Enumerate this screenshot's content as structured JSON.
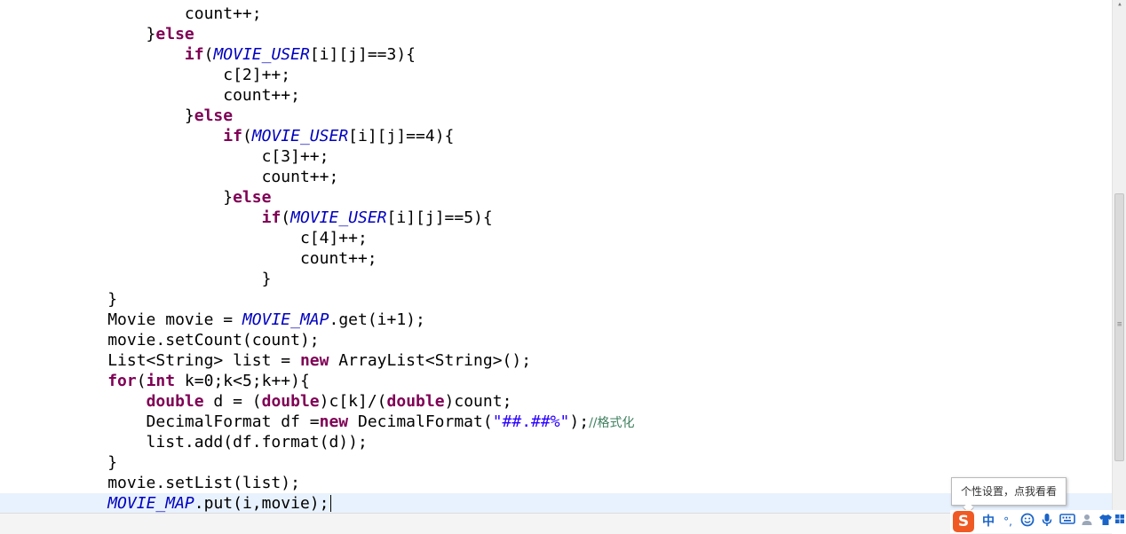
{
  "editor": {
    "lines": [
      [
        {
          "t": "                   count++;"
        }
      ],
      [
        {
          "t": "               }"
        },
        {
          "t": "else",
          "c": "kw"
        }
      ],
      [
        {
          "t": "                   "
        },
        {
          "t": "if",
          "c": "kw"
        },
        {
          "t": "("
        },
        {
          "t": "MOVIE_USER",
          "c": "st"
        },
        {
          "t": "[i][j]==3){"
        }
      ],
      [
        {
          "t": "                       c[2]++;"
        }
      ],
      [
        {
          "t": "                       count++;"
        }
      ],
      [
        {
          "t": "                   }"
        },
        {
          "t": "else",
          "c": "kw"
        }
      ],
      [
        {
          "t": "                       "
        },
        {
          "t": "if",
          "c": "kw"
        },
        {
          "t": "("
        },
        {
          "t": "MOVIE_USER",
          "c": "st"
        },
        {
          "t": "[i][j]==4){"
        }
      ],
      [
        {
          "t": "                           c[3]++;"
        }
      ],
      [
        {
          "t": "                           count++;"
        }
      ],
      [
        {
          "t": "                       }"
        },
        {
          "t": "else",
          "c": "kw"
        }
      ],
      [
        {
          "t": "                           "
        },
        {
          "t": "if",
          "c": "kw"
        },
        {
          "t": "("
        },
        {
          "t": "MOVIE_USER",
          "c": "st"
        },
        {
          "t": "[i][j]==5){"
        }
      ],
      [
        {
          "t": "                               c[4]++;"
        }
      ],
      [
        {
          "t": "                               count++;"
        }
      ],
      [
        {
          "t": "                           }"
        }
      ],
      [
        {
          "t": "           }"
        }
      ],
      [
        {
          "t": "           Movie movie = "
        },
        {
          "t": "MOVIE_MAP",
          "c": "st"
        },
        {
          "t": ".get(i+1);"
        }
      ],
      [
        {
          "t": "           movie.setCount(count);"
        }
      ],
      [
        {
          "t": "           List<String> list = "
        },
        {
          "t": "new",
          "c": "kw"
        },
        {
          "t": " ArrayList<String>();"
        }
      ],
      [
        {
          "t": "           "
        },
        {
          "t": "for",
          "c": "kw"
        },
        {
          "t": "("
        },
        {
          "t": "int",
          "c": "kw"
        },
        {
          "t": " k=0;k<5;k++){"
        }
      ],
      [
        {
          "t": "               "
        },
        {
          "t": "double",
          "c": "kw"
        },
        {
          "t": " d = ("
        },
        {
          "t": "double",
          "c": "kw"
        },
        {
          "t": ")c[k]/("
        },
        {
          "t": "double",
          "c": "kw"
        },
        {
          "t": ")count;"
        }
      ],
      [
        {
          "t": "               DecimalFormat df ="
        },
        {
          "t": "new",
          "c": "kw"
        },
        {
          "t": " DecimalFormat("
        },
        {
          "t": "\"##.##%\"",
          "c": "str"
        },
        {
          "t": ");"
        },
        {
          "t": "//格式化",
          "c": "cm"
        }
      ],
      [
        {
          "t": "               list.add(df.format(d));"
        }
      ],
      [
        {
          "t": "           }"
        }
      ],
      [
        {
          "t": "           movie.setList(list);"
        }
      ],
      [
        {
          "t": "           "
        },
        {
          "t": "MOVIE_MAP",
          "c": "st"
        },
        {
          "t": ".put(i,movie);"
        }
      ]
    ]
  },
  "tooltip": {
    "text": "个性设置，点我看看"
  },
  "ime": {
    "logo": "S",
    "mode": "中",
    "punct": "°,",
    "icons": [
      "smiley-icon",
      "microphone-icon",
      "keyboard-icon",
      "user-icon",
      "shirt-icon",
      "grid-icon"
    ]
  }
}
